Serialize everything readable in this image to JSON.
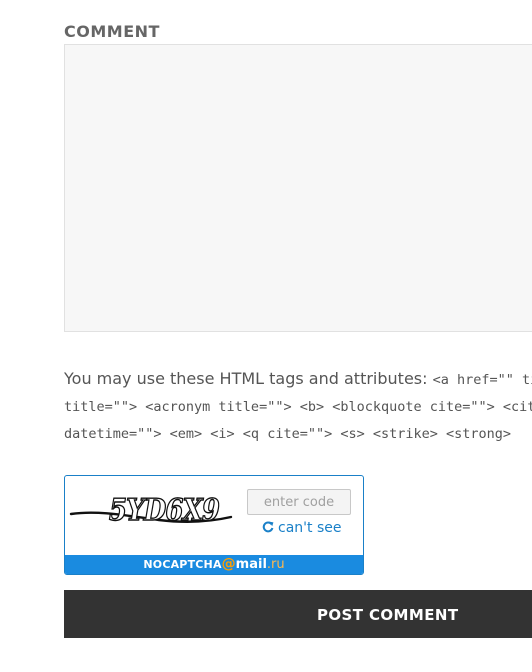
{
  "comment_form": {
    "label": "COMMENT",
    "textarea_value": ""
  },
  "allowed_tags": {
    "intro": "You may use these HTML tags and attributes: ",
    "line1_code": "<a href=\"\" title=\"\"> <abbr",
    "line2_code": "title=\"\"> <acronym title=\"\"> <b> <blockquote cite=\"\"> <cite> <code> <del",
    "line3_code": "datetime=\"\"> <em> <i> <q cite=\"\"> <s> <strike> <strong>"
  },
  "captcha": {
    "image_text": "5YD6X9",
    "input_placeholder": "enter code",
    "input_value": "",
    "cant_see_label": "can't see",
    "footer_brand": "NOCAPTCHA",
    "footer_at": "@",
    "footer_mail": "mail",
    "footer_ru": ".ru",
    "colors": {
      "border": "#1a80c8",
      "footer_bg": "#1a8be0",
      "link": "#1a80c8",
      "accent": "#ff9e00"
    },
    "icons": {
      "refresh": "refresh-icon"
    }
  },
  "submit": {
    "label": "POST COMMENT"
  }
}
